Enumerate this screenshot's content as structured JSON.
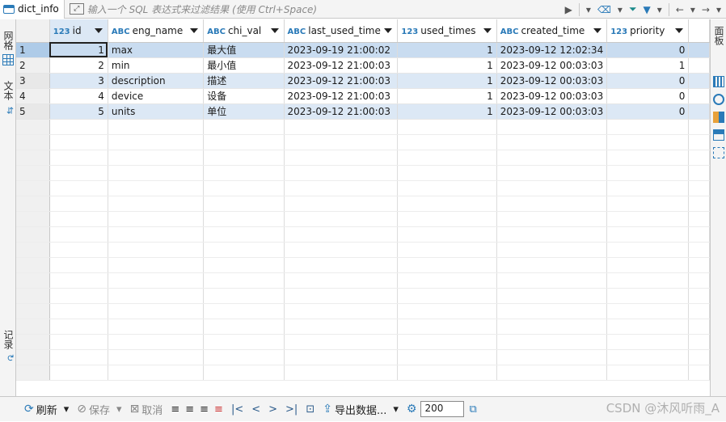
{
  "tab": {
    "name": "dict_info"
  },
  "filter": {
    "placeholder": "输入一个 SQL 表达式来过滤结果 (使用 Ctrl+Space)"
  },
  "left_panel": {
    "tab_grid": "网格",
    "tab_text": "文本",
    "tab_record": "记录"
  },
  "right_panel": {
    "tab_panels": "面板"
  },
  "columns": [
    {
      "type": "123",
      "name": "id"
    },
    {
      "type": "ABC",
      "name": "eng_name"
    },
    {
      "type": "ABC",
      "name": "chi_val"
    },
    {
      "type": "ABC",
      "name": "last_used_time"
    },
    {
      "type": "123",
      "name": "used_times"
    },
    {
      "type": "ABC",
      "name": "created_time"
    },
    {
      "type": "123",
      "name": "priority"
    }
  ],
  "rows": [
    {
      "rn": "1",
      "id": "1",
      "eng_name": "max",
      "chi_val": "最大值",
      "last_used_time": "2023-09-19 21:00:02",
      "used_times": "1",
      "created_time": "2023-09-12 12:02:34",
      "priority": "0"
    },
    {
      "rn": "2",
      "id": "2",
      "eng_name": "min",
      "chi_val": "最小值",
      "last_used_time": "2023-09-12 21:00:03",
      "used_times": "1",
      "created_time": "2023-09-12 00:03:03",
      "priority": "1"
    },
    {
      "rn": "3",
      "id": "3",
      "eng_name": "description",
      "chi_val": "描述",
      "last_used_time": "2023-09-12 21:00:03",
      "used_times": "1",
      "created_time": "2023-09-12 00:03:03",
      "priority": "0"
    },
    {
      "rn": "4",
      "id": "4",
      "eng_name": "device",
      "chi_val": "设备",
      "last_used_time": "2023-09-12 21:00:03",
      "used_times": "1",
      "created_time": "2023-09-12 00:03:03",
      "priority": "0"
    },
    {
      "rn": "5",
      "id": "5",
      "eng_name": "units",
      "chi_val": "单位",
      "last_used_time": "2023-09-12 21:00:03",
      "used_times": "1",
      "created_time": "2023-09-12 00:03:03",
      "priority": "0"
    }
  ],
  "bottom": {
    "refresh": "刷新",
    "save": "保存",
    "cancel": "取消",
    "export": "导出数据...",
    "fetch_size": "200"
  },
  "watermark": "CSDN @沐风听雨_A",
  "colors": {
    "accent": "#2a7ab8",
    "selected_row": "#c9dcf0",
    "alt_row": "#dce8f5"
  }
}
